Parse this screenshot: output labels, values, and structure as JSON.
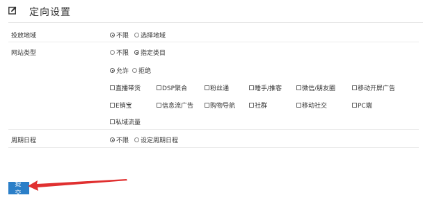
{
  "header": {
    "title": "定向设置",
    "icon": "edit-icon"
  },
  "delivery_region": {
    "label": "投放地域",
    "options": [
      {
        "label": "不限",
        "checked": true
      },
      {
        "label": "选择地域",
        "checked": false
      }
    ]
  },
  "website_type": {
    "label": "网站类型",
    "mode_options": [
      {
        "label": "不限",
        "checked": false
      },
      {
        "label": "指定类目",
        "checked": true
      }
    ],
    "permit_options": [
      {
        "label": "允许",
        "checked": true
      },
      {
        "label": "拒绝",
        "checked": false
      }
    ],
    "categories_row1": [
      "直播带货",
      "DSP聚合",
      "粉丝通",
      "睡手/推客",
      "微信/朋友圈",
      "移动开屏广告"
    ],
    "categories_row2": [
      "E销宝",
      "信息流广告",
      "购物导航",
      "社群",
      "移动社交",
      "PC端"
    ],
    "categories_row3": [
      "私域流量"
    ]
  },
  "schedule": {
    "label": "周期日程",
    "options": [
      {
        "label": "不限",
        "checked": true
      },
      {
        "label": "设定周期日程",
        "checked": false
      }
    ]
  },
  "submit_label": "提交",
  "colors": {
    "submit_bg": "#2b7fc8",
    "arrow": "#e03030"
  }
}
